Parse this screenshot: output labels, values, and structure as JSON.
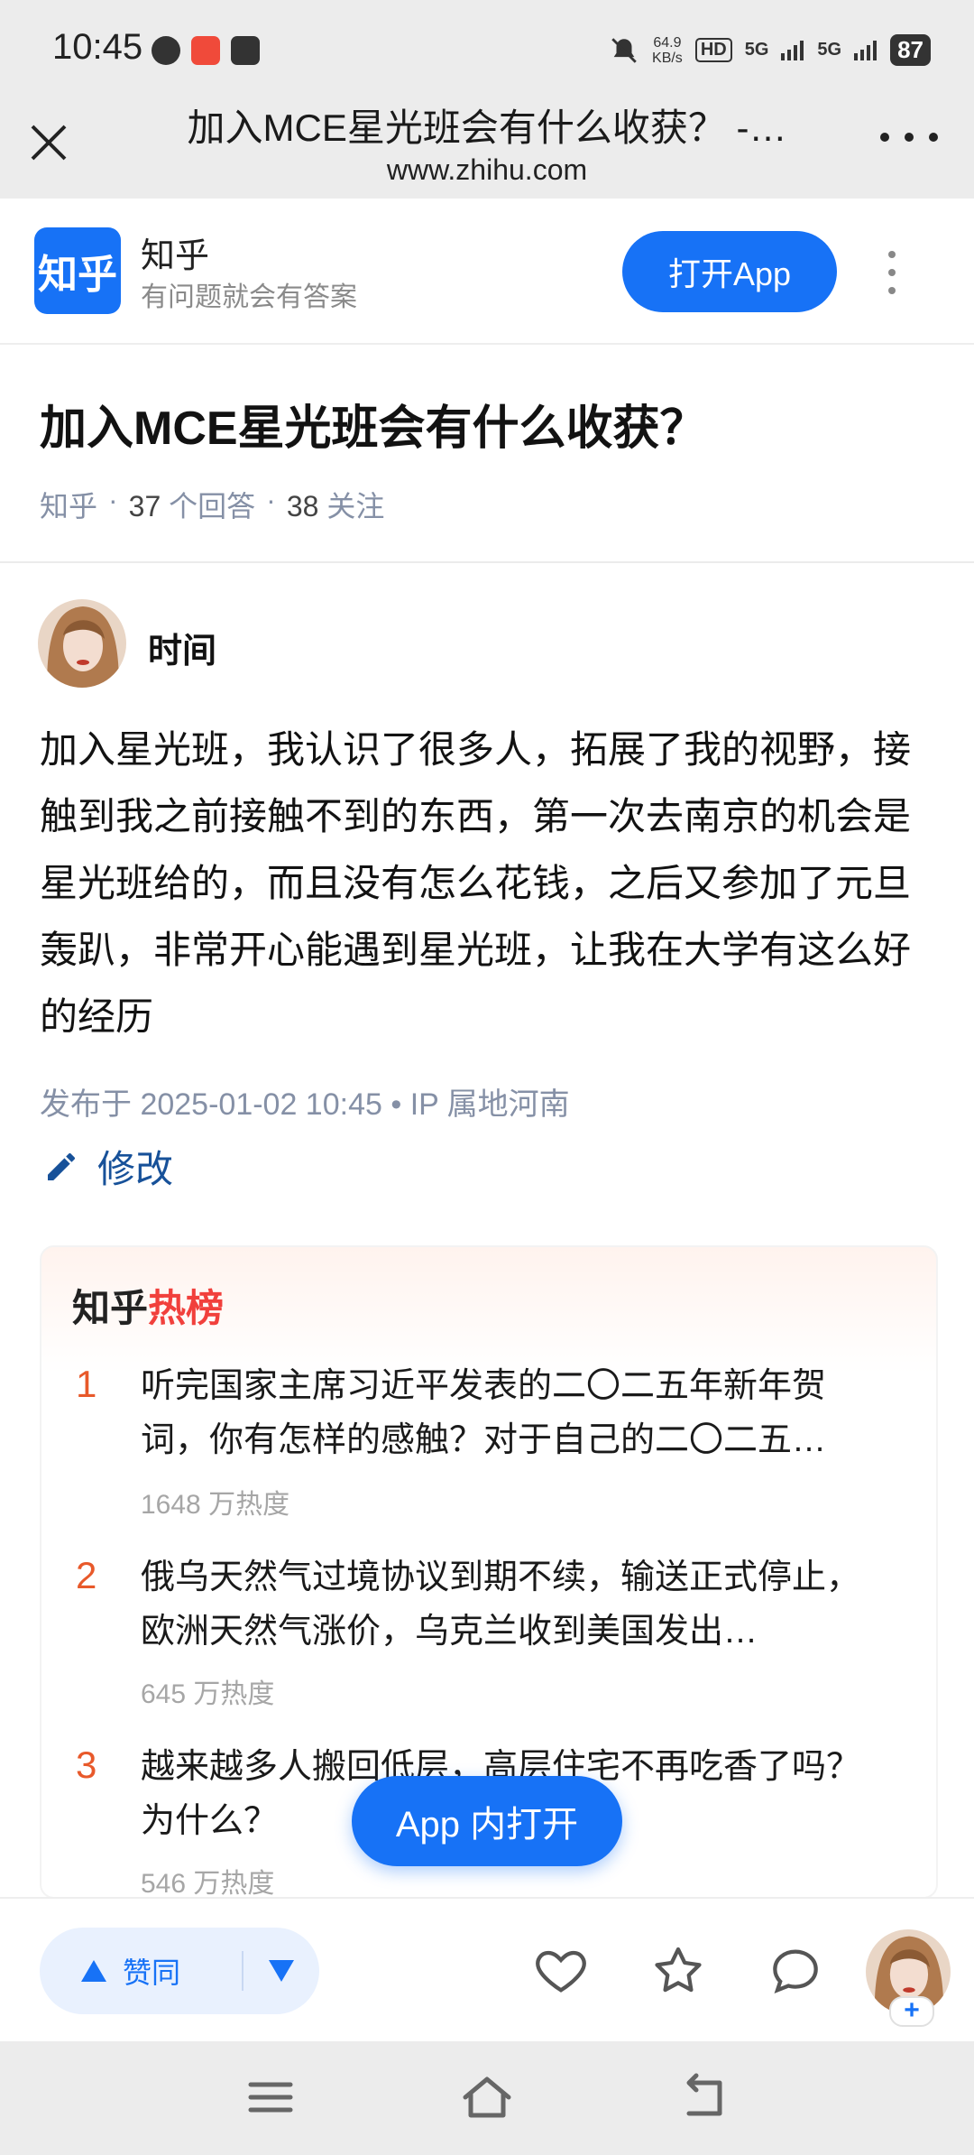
{
  "status_bar": {
    "time": "10:45",
    "net_speed_value": "64.9",
    "net_speed_unit": "KB/s",
    "hd": "HD",
    "signal_1": "5G",
    "signal_2": "5G",
    "battery": "87"
  },
  "browser": {
    "title": "加入MCE星光班会有什么收获？ -…",
    "url": "www.zhihu.com"
  },
  "banner": {
    "logo_text": "知乎",
    "brand": "知乎",
    "slogan": "有问题就会有答案",
    "open_app": "打开App"
  },
  "question": {
    "title": "加入MCE星光班会有什么收获？",
    "source": "知乎",
    "sep": "·",
    "answers_count": "37",
    "answers_label": "个回答",
    "follow_count": "38",
    "follow_label": "关注"
  },
  "answer": {
    "author": "时间",
    "content": "加入星光班，我认识了很多人，拓展了我的视野，接触到我之前接触不到的东西，第一次去南京的机会是星光班给的，而且没有怎么花钱，之后又参加了元旦轰趴，非常开心能遇到星光班，让我在大学有这么好的经历",
    "published": "发布于 2025-01-02 10:45 • IP 属地河南",
    "edit_label": "修改"
  },
  "hot_list": {
    "title_prefix": "知乎",
    "title_accent": "热榜",
    "items": [
      {
        "rank": "1",
        "text": "听完国家主席习近平发表的二〇二五年新年贺词，你有怎样的感触？对于自己的二〇二五…",
        "heat": "1648 万热度"
      },
      {
        "rank": "2",
        "text": "俄乌天然气过境协议到期不续，输送正式停止，欧洲天然气涨价，乌克兰收到美国发出…",
        "heat": "645 万热度"
      },
      {
        "rank": "3",
        "text": "越来越多人搬回低层，高层住宅不再吃香了吗？为什么？",
        "heat": "546 万热度"
      }
    ]
  },
  "floating_button": "App 内打开",
  "action_bar": {
    "upvote_label": "赞同",
    "plus": "+"
  },
  "colors": {
    "brand_blue": "#1772f6",
    "hot_rank": "#e8592a",
    "hot_accent": "#f1403c",
    "link_blue": "#175199"
  }
}
